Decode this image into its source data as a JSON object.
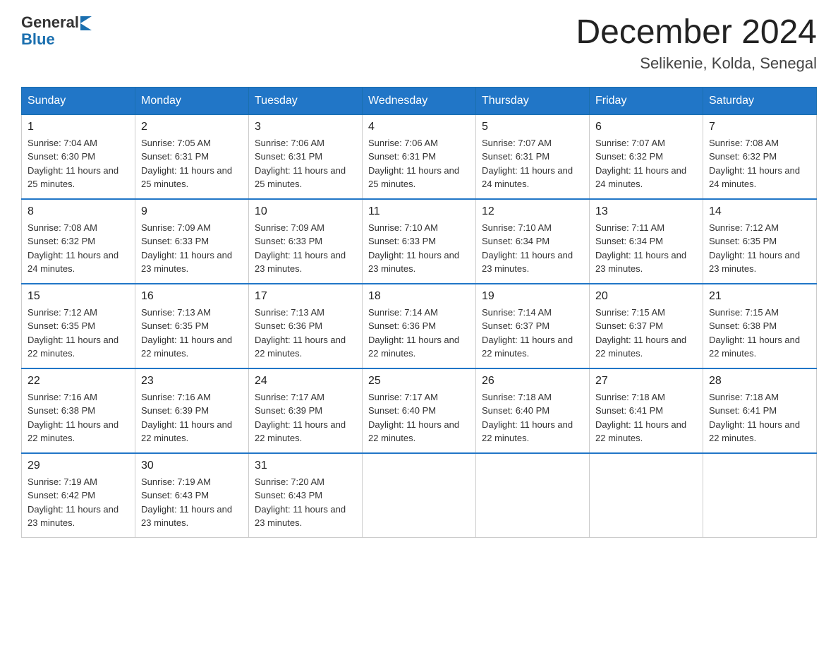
{
  "header": {
    "logo_general": "General",
    "logo_blue": "Blue",
    "month_title": "December 2024",
    "location": "Selikenie, Kolda, Senegal"
  },
  "weekdays": [
    "Sunday",
    "Monday",
    "Tuesday",
    "Wednesday",
    "Thursday",
    "Friday",
    "Saturday"
  ],
  "weeks": [
    [
      {
        "day": "1",
        "sunrise": "7:04 AM",
        "sunset": "6:30 PM",
        "daylight": "11 hours and 25 minutes."
      },
      {
        "day": "2",
        "sunrise": "7:05 AM",
        "sunset": "6:31 PM",
        "daylight": "11 hours and 25 minutes."
      },
      {
        "day": "3",
        "sunrise": "7:06 AM",
        "sunset": "6:31 PM",
        "daylight": "11 hours and 25 minutes."
      },
      {
        "day": "4",
        "sunrise": "7:06 AM",
        "sunset": "6:31 PM",
        "daylight": "11 hours and 25 minutes."
      },
      {
        "day": "5",
        "sunrise": "7:07 AM",
        "sunset": "6:31 PM",
        "daylight": "11 hours and 24 minutes."
      },
      {
        "day": "6",
        "sunrise": "7:07 AM",
        "sunset": "6:32 PM",
        "daylight": "11 hours and 24 minutes."
      },
      {
        "day": "7",
        "sunrise": "7:08 AM",
        "sunset": "6:32 PM",
        "daylight": "11 hours and 24 minutes."
      }
    ],
    [
      {
        "day": "8",
        "sunrise": "7:08 AM",
        "sunset": "6:32 PM",
        "daylight": "11 hours and 24 minutes."
      },
      {
        "day": "9",
        "sunrise": "7:09 AM",
        "sunset": "6:33 PM",
        "daylight": "11 hours and 23 minutes."
      },
      {
        "day": "10",
        "sunrise": "7:09 AM",
        "sunset": "6:33 PM",
        "daylight": "11 hours and 23 minutes."
      },
      {
        "day": "11",
        "sunrise": "7:10 AM",
        "sunset": "6:33 PM",
        "daylight": "11 hours and 23 minutes."
      },
      {
        "day": "12",
        "sunrise": "7:10 AM",
        "sunset": "6:34 PM",
        "daylight": "11 hours and 23 minutes."
      },
      {
        "day": "13",
        "sunrise": "7:11 AM",
        "sunset": "6:34 PM",
        "daylight": "11 hours and 23 minutes."
      },
      {
        "day": "14",
        "sunrise": "7:12 AM",
        "sunset": "6:35 PM",
        "daylight": "11 hours and 23 minutes."
      }
    ],
    [
      {
        "day": "15",
        "sunrise": "7:12 AM",
        "sunset": "6:35 PM",
        "daylight": "11 hours and 22 minutes."
      },
      {
        "day": "16",
        "sunrise": "7:13 AM",
        "sunset": "6:35 PM",
        "daylight": "11 hours and 22 minutes."
      },
      {
        "day": "17",
        "sunrise": "7:13 AM",
        "sunset": "6:36 PM",
        "daylight": "11 hours and 22 minutes."
      },
      {
        "day": "18",
        "sunrise": "7:14 AM",
        "sunset": "6:36 PM",
        "daylight": "11 hours and 22 minutes."
      },
      {
        "day": "19",
        "sunrise": "7:14 AM",
        "sunset": "6:37 PM",
        "daylight": "11 hours and 22 minutes."
      },
      {
        "day": "20",
        "sunrise": "7:15 AM",
        "sunset": "6:37 PM",
        "daylight": "11 hours and 22 minutes."
      },
      {
        "day": "21",
        "sunrise": "7:15 AM",
        "sunset": "6:38 PM",
        "daylight": "11 hours and 22 minutes."
      }
    ],
    [
      {
        "day": "22",
        "sunrise": "7:16 AM",
        "sunset": "6:38 PM",
        "daylight": "11 hours and 22 minutes."
      },
      {
        "day": "23",
        "sunrise": "7:16 AM",
        "sunset": "6:39 PM",
        "daylight": "11 hours and 22 minutes."
      },
      {
        "day": "24",
        "sunrise": "7:17 AM",
        "sunset": "6:39 PM",
        "daylight": "11 hours and 22 minutes."
      },
      {
        "day": "25",
        "sunrise": "7:17 AM",
        "sunset": "6:40 PM",
        "daylight": "11 hours and 22 minutes."
      },
      {
        "day": "26",
        "sunrise": "7:18 AM",
        "sunset": "6:40 PM",
        "daylight": "11 hours and 22 minutes."
      },
      {
        "day": "27",
        "sunrise": "7:18 AM",
        "sunset": "6:41 PM",
        "daylight": "11 hours and 22 minutes."
      },
      {
        "day": "28",
        "sunrise": "7:18 AM",
        "sunset": "6:41 PM",
        "daylight": "11 hours and 22 minutes."
      }
    ],
    [
      {
        "day": "29",
        "sunrise": "7:19 AM",
        "sunset": "6:42 PM",
        "daylight": "11 hours and 23 minutes."
      },
      {
        "day": "30",
        "sunrise": "7:19 AM",
        "sunset": "6:43 PM",
        "daylight": "11 hours and 23 minutes."
      },
      {
        "day": "31",
        "sunrise": "7:20 AM",
        "sunset": "6:43 PM",
        "daylight": "11 hours and 23 minutes."
      },
      null,
      null,
      null,
      null
    ]
  ],
  "labels": {
    "sunrise_prefix": "Sunrise: ",
    "sunset_prefix": "Sunset: ",
    "daylight_prefix": "Daylight: "
  }
}
